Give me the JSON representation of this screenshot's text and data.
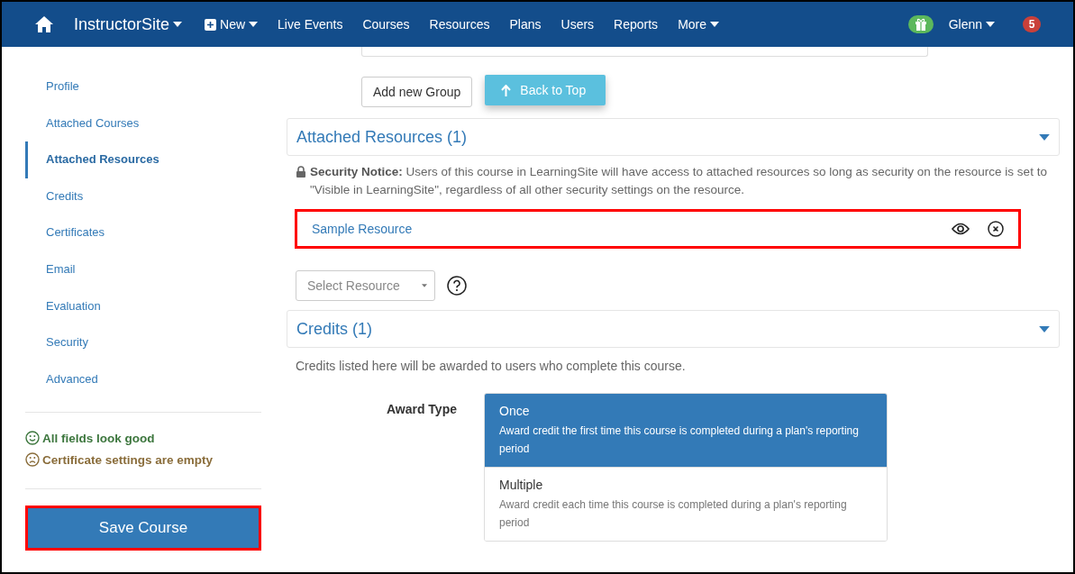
{
  "navbar": {
    "brand": "InstructorSite",
    "new_label": "New",
    "links": [
      "Live Events",
      "Courses",
      "Resources",
      "Plans",
      "Users",
      "Reports"
    ],
    "more_label": "More",
    "user": "Glenn",
    "notification_count": "5"
  },
  "sidebar": {
    "items": [
      {
        "label": "Profile",
        "selected": false
      },
      {
        "label": "Attached Courses",
        "selected": false
      },
      {
        "label": "Attached Resources",
        "selected": true
      },
      {
        "label": "Credits",
        "selected": false
      },
      {
        "label": "Certificates",
        "selected": false
      },
      {
        "label": "Email",
        "selected": false
      },
      {
        "label": "Evaluation",
        "selected": false
      },
      {
        "label": "Security",
        "selected": false
      },
      {
        "label": "Advanced",
        "selected": false
      }
    ],
    "status": [
      {
        "kind": "good",
        "text": "All fields look good"
      },
      {
        "kind": "bad",
        "text": "Certificate settings are empty"
      }
    ],
    "save_button": {
      "label": "Save Course",
      "highlighted": true
    }
  },
  "main": {
    "add_group_button": "Add new Group",
    "back_to_top_button": "Back to Top",
    "attached_resources": {
      "title": "Attached Resources (1)",
      "expanded": true,
      "notice": "**Security Notice:** Users of this course in LearningSite will have access to attached resources so long as security on the resource is set to \"Visible in LearningSite\", regardless of all other security settings on the resource.",
      "resources": [
        {
          "name": "Sample Resource",
          "highlighted": true
        }
      ],
      "select_placeholder": "Select Resource"
    },
    "credits": {
      "title": "Credits (1)",
      "expanded": true,
      "description": "Credits listed here will be awarded to users who complete this course.",
      "award_type_label": "Award Type",
      "award_options": [
        {
          "title": "Once",
          "description": "Award credit the first time this course is completed during a plan's reporting period",
          "selected": true
        },
        {
          "title": "Multiple",
          "description": "Award credit each time this course is completed during a plan's reporting period",
          "selected": false
        }
      ]
    }
  }
}
